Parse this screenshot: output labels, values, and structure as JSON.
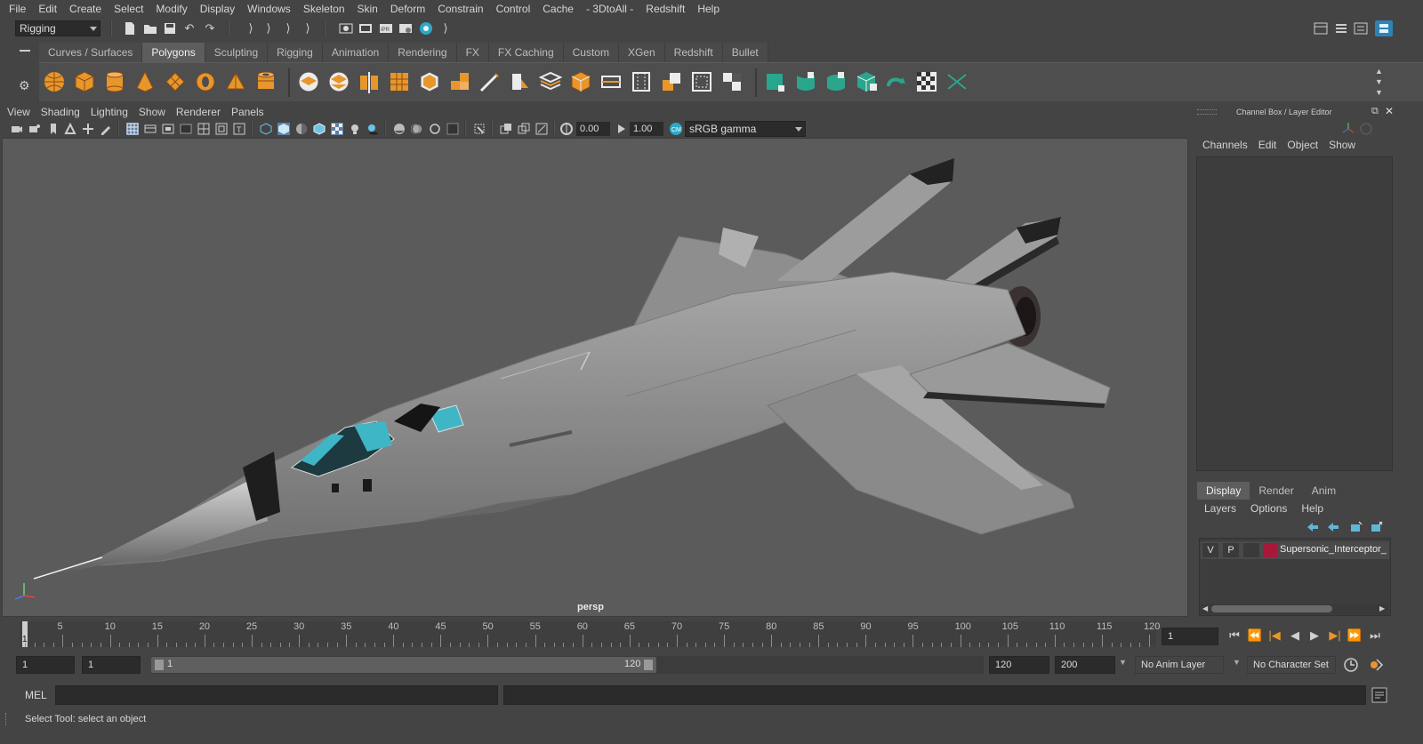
{
  "menu": [
    "File",
    "Edit",
    "Create",
    "Select",
    "Modify",
    "Display",
    "Windows",
    "Skeleton",
    "Skin",
    "Deform",
    "Constrain",
    "Control",
    "Cache",
    "- 3DtoAll -",
    "Redshift",
    "Help"
  ],
  "status_line": {
    "menu_set": "Rigging"
  },
  "shelf": {
    "tabs": [
      "Curves / Surfaces",
      "Polygons",
      "Sculpting",
      "Rigging",
      "Animation",
      "Rendering",
      "FX",
      "FX Caching",
      "Custom",
      "XGen",
      "Redshift",
      "Bullet"
    ],
    "active_tab": "Polygons"
  },
  "viewport": {
    "menu": [
      "View",
      "Shading",
      "Lighting",
      "Show",
      "Renderer",
      "Panels"
    ],
    "exposure": "0.00",
    "gamma": "1.00",
    "color_space": "sRGB gamma",
    "camera_label": "persp"
  },
  "channel_box": {
    "title": "Channel Box / Layer Editor",
    "menu": [
      "Channels",
      "Edit",
      "Object",
      "Show"
    ]
  },
  "layer_editor": {
    "tabs": [
      "Display",
      "Render",
      "Anim"
    ],
    "active_tab": "Display",
    "menu": [
      "Layers",
      "Options",
      "Help"
    ],
    "layers": [
      {
        "visible": "V",
        "playback": "P",
        "name": "Supersonic_Interceptor_",
        "color": "#a8183a"
      }
    ]
  },
  "time_slider": {
    "ticks": [
      "5",
      "10",
      "15",
      "20",
      "25",
      "30",
      "35",
      "40",
      "45",
      "50",
      "55",
      "60",
      "65",
      "70",
      "75",
      "80",
      "85",
      "90",
      "95",
      "100",
      "105",
      "110",
      "115",
      "120"
    ],
    "start_marker": "1",
    "current_frame": "1"
  },
  "range_slider": {
    "start_frame": "1",
    "playback_start": "1",
    "range_start_label": "1",
    "range_end_label": "120",
    "playback_end": "120",
    "end_frame": "200",
    "anim_layer": "No Anim Layer",
    "character_set": "No Character Set"
  },
  "command_line": {
    "language": "MEL"
  },
  "help_line": {
    "text": "Select Tool: select an object"
  }
}
